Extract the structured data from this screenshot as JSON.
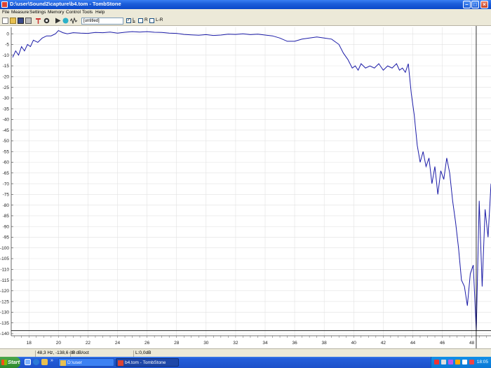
{
  "window": {
    "title": "D:\\user\\Sound2\\capture\\b4.tom - TombStone"
  },
  "menu": [
    "File",
    "Measure",
    "Settings",
    "Memory",
    "Control",
    "Tools",
    "Help"
  ],
  "toolbar": {
    "preset_value": "[untitled]",
    "channels": [
      {
        "label": "L",
        "checked": true
      },
      {
        "label": "R",
        "checked": false
      },
      {
        "label": "L-R",
        "checked": false
      }
    ]
  },
  "status": {
    "cursor_readout": "48,3 Hz, -138,6 dB",
    "slope": "? dB/oct",
    "level": "L:0,0dB"
  },
  "taskbar": {
    "start_label": "Start",
    "more_label": "»",
    "tasks": [
      {
        "label": "D:\\user",
        "active": false
      },
      {
        "label": "b4.tom - TombStone",
        "active": true
      }
    ],
    "clock": "18:05"
  },
  "chart_data": {
    "type": "line",
    "xlabel": "",
    "ylabel": "",
    "xlim": [
      16.8,
      49.3
    ],
    "ylim": [
      -141,
      3
    ],
    "x_ticks": [
      18,
      20,
      22,
      24,
      26,
      28,
      30,
      32,
      34,
      36,
      38,
      40,
      42,
      44,
      46,
      48
    ],
    "y_ticks": [
      0,
      -5,
      -10,
      -15,
      -20,
      -25,
      -30,
      -35,
      -40,
      -45,
      -50,
      -55,
      -60,
      -65,
      -70,
      -75,
      -80,
      -85,
      -90,
      -95,
      -100,
      -105,
      -110,
      -115,
      -120,
      -125,
      -130,
      -135,
      -140
    ],
    "grid": true,
    "cursor": {
      "x": 48.3,
      "y": -138.6
    },
    "color": "#1c1ca8",
    "series": [
      {
        "x": [
          16.9,
          17.1,
          17.3,
          17.5,
          17.7,
          17.9,
          18.1,
          18.3,
          18.6,
          18.9,
          19.2,
          19.5,
          19.8,
          20.0,
          20.3,
          20.6,
          21.0,
          21.5,
          22.0,
          22.5,
          23.0,
          23.5,
          24.0,
          24.5,
          25.0,
          25.5,
          26.0,
          26.5,
          27.0,
          27.5,
          28.0,
          28.5,
          29.0,
          29.5,
          30.0,
          30.5,
          31.0,
          31.5,
          32.0,
          32.5,
          33.0,
          33.5,
          34.0,
          34.5,
          35.0,
          35.5,
          36.0,
          36.5,
          37.0,
          37.5,
          38.0,
          38.5,
          39.0,
          39.3,
          39.6,
          39.9,
          40.1,
          40.3,
          40.5,
          40.8,
          41.1,
          41.4,
          41.7,
          42.0,
          42.3,
          42.6,
          42.9,
          43.1,
          43.3,
          43.5,
          43.7,
          43.9,
          44.1,
          44.3,
          44.5,
          44.7,
          44.9,
          45.1,
          45.3,
          45.5,
          45.7,
          45.9,
          46.1,
          46.3,
          46.5,
          46.7,
          46.9,
          47.1,
          47.3,
          47.5,
          47.7,
          47.9,
          48.1,
          48.3,
          48.5,
          48.7,
          48.9,
          49.1,
          49.3
        ],
        "y": [
          -11,
          -8,
          -10,
          -6,
          -8,
          -5,
          -6,
          -3,
          -4,
          -2,
          -1,
          -1,
          0,
          1.5,
          0.5,
          0,
          0.5,
          0.3,
          0.2,
          0.6,
          0.5,
          0.8,
          0.3,
          0.7,
          1,
          0.8,
          1,
          0.7,
          0.6,
          0.3,
          0.2,
          -0.3,
          -0.5,
          -0.7,
          -0.4,
          -0.8,
          -0.6,
          -0.2,
          -0.3,
          0,
          -0.4,
          -0.2,
          -0.6,
          -1,
          -2,
          -3.5,
          -3.5,
          -2.5,
          -2,
          -1.5,
          -2,
          -2.5,
          -5,
          -9,
          -12,
          -16,
          -15,
          -17,
          -14,
          -16,
          -15,
          -16,
          -14,
          -17,
          -15,
          -16,
          -14,
          -17,
          -16,
          -18,
          -14,
          -28,
          -38,
          -52,
          -60,
          -55,
          -62,
          -58,
          -70,
          -62,
          -75,
          -64,
          -68,
          -58,
          -65,
          -78,
          -88,
          -100,
          -115,
          -118,
          -127,
          -112,
          -108,
          -138.6,
          -78,
          -118,
          -82,
          -95,
          -70
        ]
      }
    ]
  }
}
